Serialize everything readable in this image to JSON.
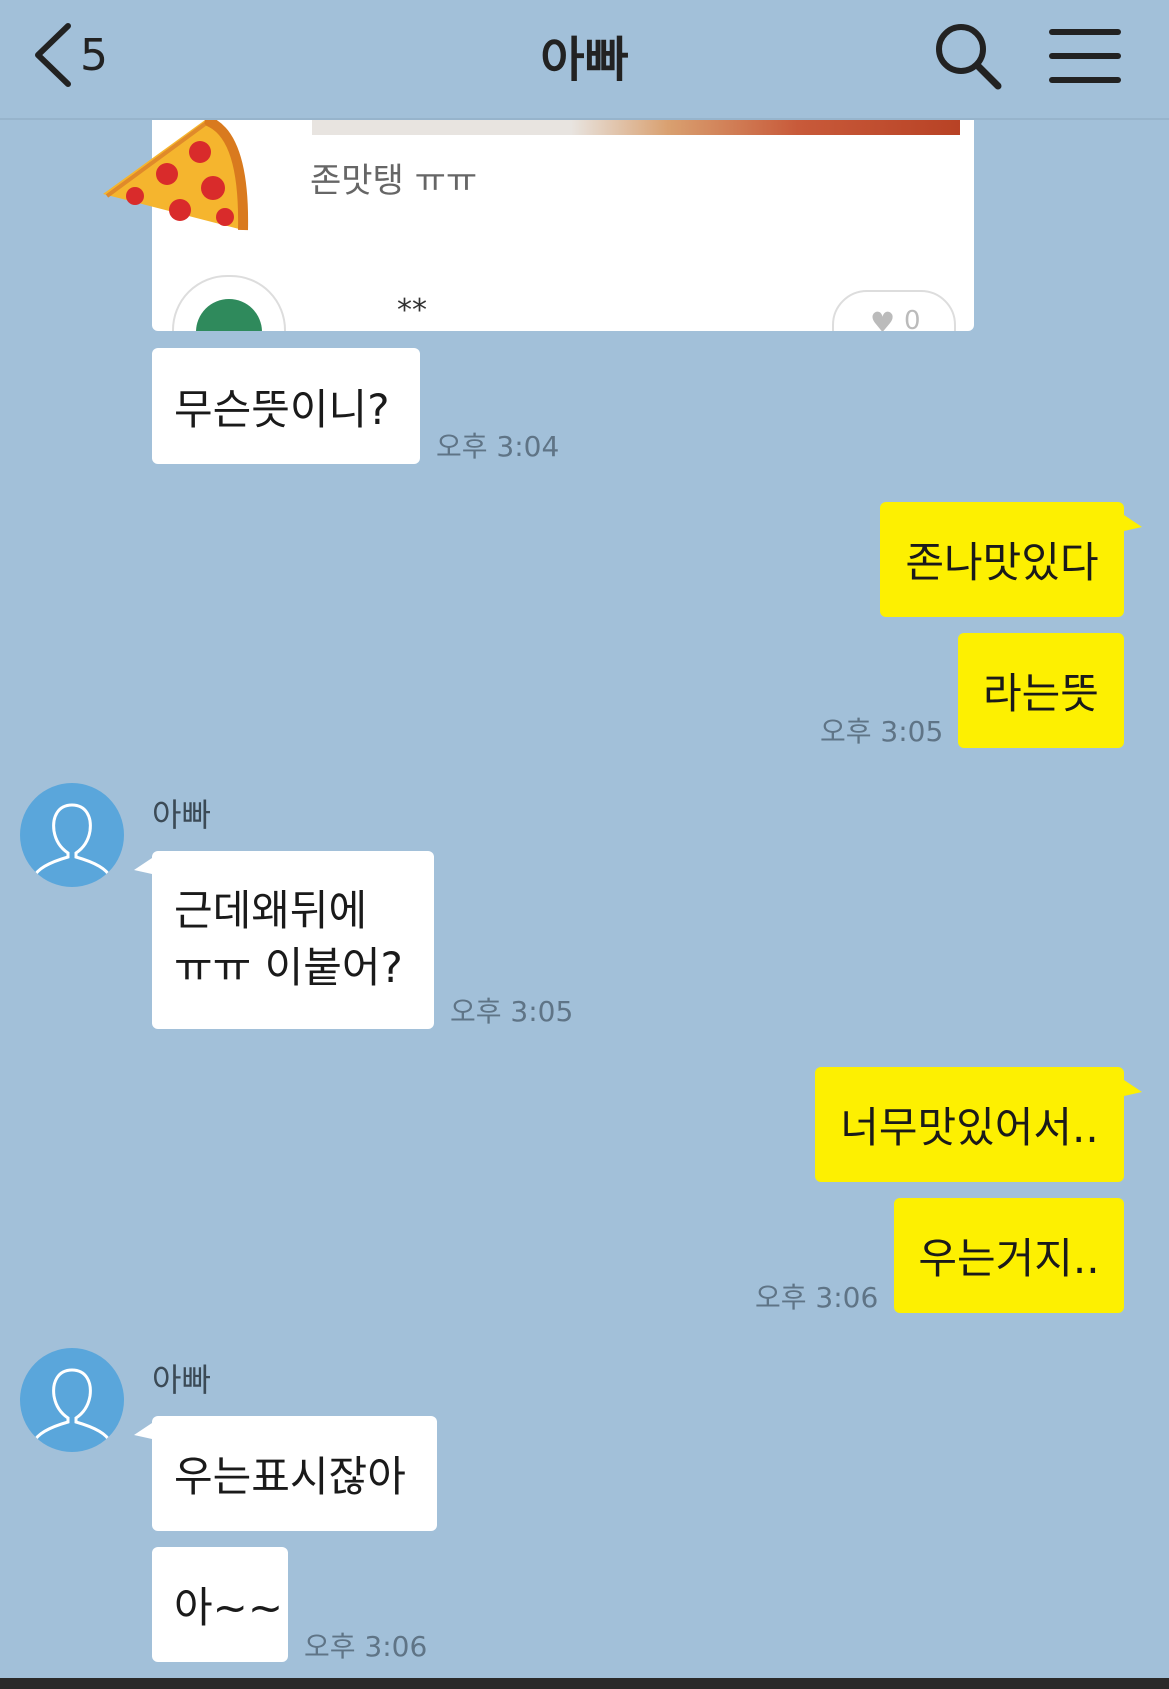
{
  "header": {
    "back_icon": "chevron-left-icon",
    "unread_count": "5",
    "title": "아빠",
    "search_icon": "search-icon",
    "menu_icon": "hamburger-menu-icon"
  },
  "shared_card": {
    "caption": "존맛탱 ㅠㅠ",
    "stars": "**",
    "like_icon": "heart-icon",
    "like_count": "0"
  },
  "messages": [
    {
      "side": "in",
      "text": "무슨뜻이니?",
      "time": "오후 3:04"
    },
    {
      "side": "out",
      "text": "존나맛있다"
    },
    {
      "side": "out",
      "text": "라는뜻",
      "time": "오후 3:05"
    },
    {
      "side": "in",
      "sender": "아빠",
      "lines": [
        "근데왜뒤에",
        "ㅠㅠ 이붙어?"
      ],
      "time": "오후 3:05"
    },
    {
      "side": "out",
      "text": "너무맛있어서.."
    },
    {
      "side": "out",
      "text": "우는거지..",
      "time": "오후 3:06"
    },
    {
      "side": "in",
      "sender": "아빠",
      "text": "우는표시잖아"
    },
    {
      "side": "in",
      "text": "아~~",
      "time": "오후 3:06"
    }
  ],
  "colors": {
    "background": "#a2c0d9",
    "outgoing_bubble": "#fdf001",
    "incoming_bubble": "#ffffff",
    "avatar": "#5aa6db"
  }
}
